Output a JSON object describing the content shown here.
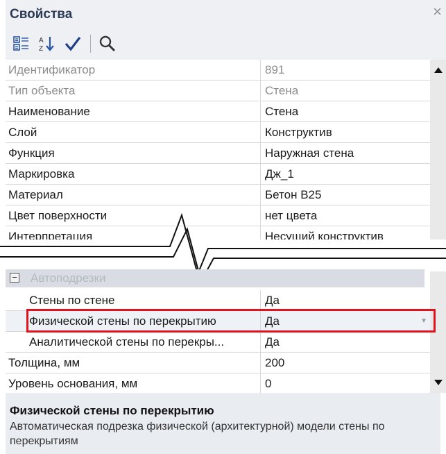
{
  "panel": {
    "title": "Свойства"
  },
  "toolbar": {
    "buttons": [
      {
        "name": "categorized-view-icon"
      },
      {
        "name": "sort-alphabetical-icon"
      },
      {
        "name": "apply-checkmark-icon"
      },
      {
        "name": "search-icon"
      }
    ]
  },
  "properties_top": [
    {
      "name": "Идентификатор",
      "value": "891",
      "readonly": true
    },
    {
      "name": "Тип объекта",
      "value": "Стена",
      "readonly": true
    },
    {
      "name": "Наименование",
      "value": "Стена",
      "readonly": false
    },
    {
      "name": "Слой",
      "value": "Конструктив",
      "readonly": false
    },
    {
      "name": "Функция",
      "value": "Наружная стена",
      "readonly": false
    },
    {
      "name": "Маркировка",
      "value": "Дж_1",
      "readonly": false
    },
    {
      "name": "Материал",
      "value": "Бетон B25",
      "readonly": false
    },
    {
      "name": "Цвет поверхности",
      "value": "нет цвета",
      "readonly": false
    },
    {
      "name": "Интерпретация",
      "value": "Несущий конструктив",
      "readonly": false
    }
  ],
  "group": {
    "label": "Автоподрезки",
    "toggle": "⊟"
  },
  "properties_group": [
    {
      "name": "Стены по стене",
      "value": "Да"
    },
    {
      "name": "Физической стены по перекрытию",
      "value": "Да"
    },
    {
      "name": "Аналитической стены по перекры...",
      "value": "Да"
    }
  ],
  "properties_bottom": [
    {
      "name": "Толщина, мм",
      "value": "200"
    },
    {
      "name": "Уровень основания, мм",
      "value": "0"
    }
  ],
  "description": {
    "title": "Физической стены по перекрытию",
    "text": "Автоматическая подрезка физической (архитектурной) модели стены по перекрытиям"
  },
  "colors": {
    "highlight": "#e0141e",
    "group_bg": "#d9dde3",
    "header_bg": "#eef0f3"
  }
}
